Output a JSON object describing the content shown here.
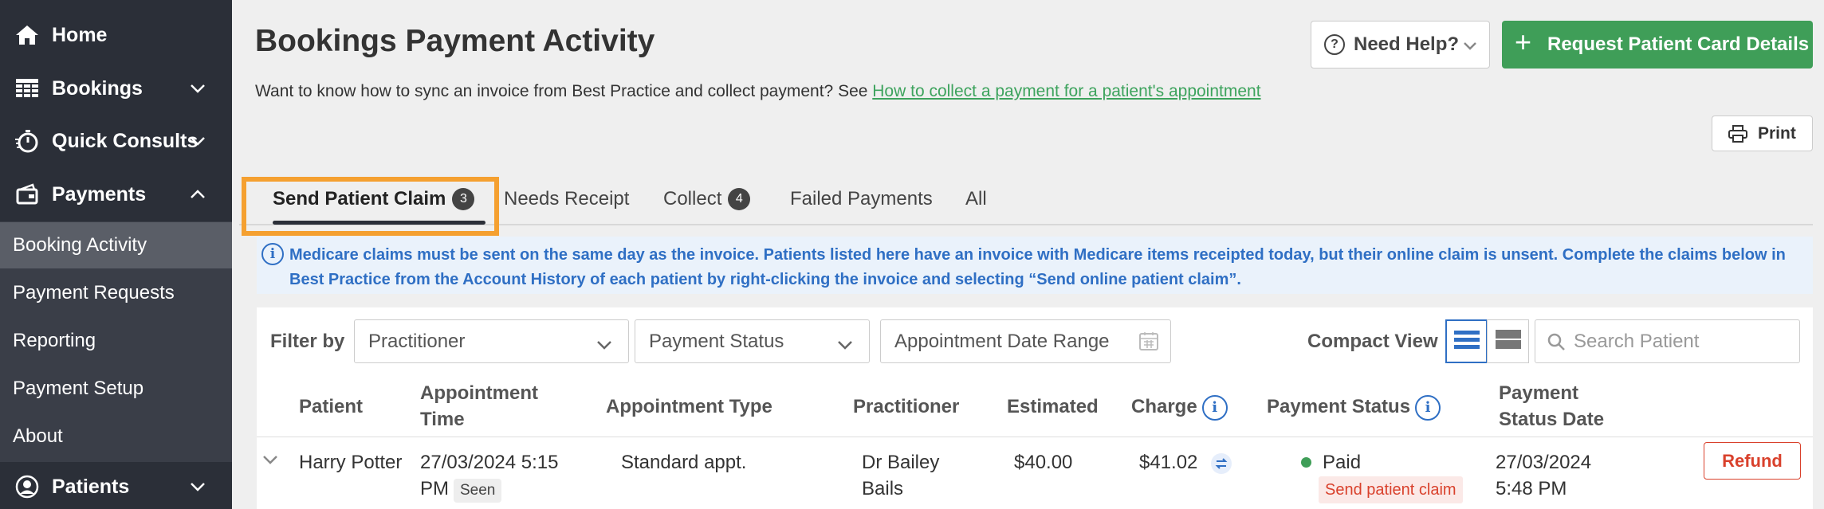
{
  "sidebar": {
    "items": [
      {
        "label": "Home",
        "icon": "home-icon"
      },
      {
        "label": "Bookings",
        "icon": "bookings-grid-icon"
      },
      {
        "label": "Quick Consults",
        "icon": "stopwatch-icon"
      },
      {
        "label": "Payments",
        "icon": "payments-card-icon"
      },
      {
        "label": "Patients",
        "icon": "patient-avatar-icon"
      }
    ],
    "payments_sub": [
      {
        "label": "Booking Activity",
        "active": true
      },
      {
        "label": "Payment Requests"
      },
      {
        "label": "Reporting"
      },
      {
        "label": "Payment Setup"
      },
      {
        "label": "About"
      }
    ]
  },
  "header": {
    "title": "Bookings Payment Activity",
    "subtitle": "Want to know how to sync an invoice from Best Practice and collect payment? See ",
    "subtitle_link": "How to collect a payment for a patient's appointment",
    "help_label": "Need Help?",
    "request_label": "Request Patient Card Details",
    "print_label": "Print"
  },
  "tabs": [
    {
      "label": "Send Patient Claim",
      "count": "3",
      "active": true
    },
    {
      "label": "Needs Receipt"
    },
    {
      "label": "Collect",
      "count": "4"
    },
    {
      "label": "Failed Payments"
    },
    {
      "label": "All"
    }
  ],
  "info_banner": "Medicare claims must be sent on the same day as the invoice. Patients listed here have an invoice with Medicare items receipted today, but their online claim is unsent. Complete the claims below in Best Practice from the Account History of each patient by right-clicking the invoice and selecting “Send online patient claim”.",
  "filters": {
    "label": "Filter by",
    "practitioner": "Practitioner",
    "payment_status": "Payment Status",
    "date_range": "Appointment Date Range",
    "compact_view": "Compact View",
    "search_placeholder": "Search Patient"
  },
  "table": {
    "headers": {
      "patient": "Patient",
      "appt_time_1": "Appointment",
      "appt_time_2": "Time",
      "appt_type": "Appointment Type",
      "practitioner": "Practitioner",
      "estimated": "Estimated",
      "charge": "Charge",
      "payment_status": "Payment Status",
      "status_date_1": "Payment",
      "status_date_2": "Status Date"
    },
    "rows": [
      {
        "patient": "Harry Potter",
        "time_1": "27/03/2024 5:15",
        "time_2": "PM",
        "seen": "Seen",
        "type": "Standard appt.",
        "practitioner_1": "Dr Bailey",
        "practitioner_2": "Bails",
        "estimated": "$40.00",
        "charge": "$41.02",
        "status": "Paid",
        "status_sub": "Send patient claim",
        "date_1": "27/03/2024",
        "date_2": "5:48 PM",
        "action": "Refund"
      }
    ]
  },
  "colors": {
    "sidebar_bg": "#2b2f38",
    "accent_green": "#3f9e58",
    "info_blue": "#2f6fc4",
    "danger_red": "#d9412c",
    "highlight_orange": "#f5a030"
  }
}
